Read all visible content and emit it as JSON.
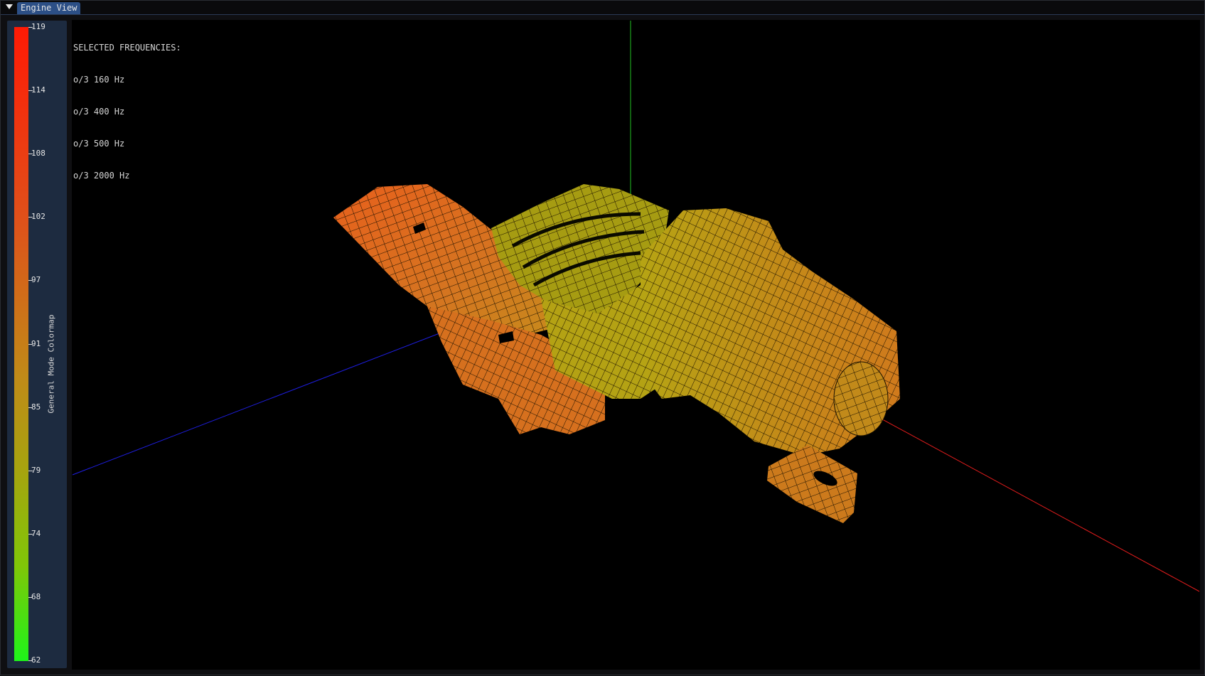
{
  "window": {
    "tab_label": "Engine View"
  },
  "colorbar": {
    "title": "General Mode Colormap",
    "ticks": [
      "119",
      "114",
      "108",
      "102",
      "97",
      "91",
      "85",
      "79",
      "74",
      "68",
      "62"
    ],
    "min_color": "#1ef41a",
    "max_color": "#ff1a05"
  },
  "frequencies": {
    "header": "SELECTED FREQUENCIES:",
    "items": [
      "o/3 160 Hz",
      "o/3 400 Hz",
      "o/3 500 Hz",
      "o/3 2000 Hz"
    ]
  },
  "axes": {
    "x_color": "#ff2020",
    "y_color": "#20d020",
    "z_color": "#2020ff"
  }
}
